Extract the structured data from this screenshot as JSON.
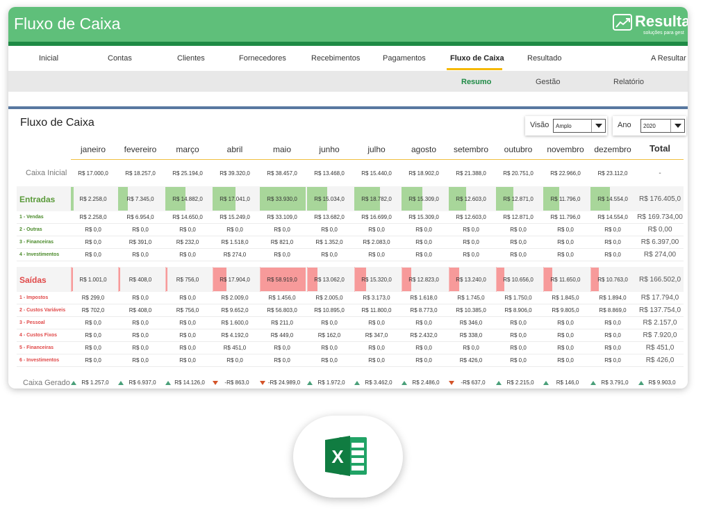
{
  "app": {
    "title": "Fluxo de Caixa",
    "brand": "Resulta",
    "brand_sub": "soluções para gest"
  },
  "nav": [
    "Inicial",
    "Contas",
    "Clientes",
    "Fornecedores",
    "Recebimentos",
    "Pagamentos",
    "Fluxo de Caixa",
    "Resultado",
    "A Resultar"
  ],
  "nav_active": "Fluxo de Caixa",
  "subnav": [
    "Resumo",
    "Gestão",
    "Relatório"
  ],
  "section_title": "Fluxo de Caixa",
  "filters": {
    "visao_label": "Visão",
    "visao_value": "Amplo",
    "ano_label": "Ano",
    "ano_value": "2020"
  },
  "months": [
    "janeiro",
    "fevereiro",
    "março",
    "abril",
    "maio",
    "junho",
    "julho",
    "agosto",
    "setembro",
    "outubro",
    "novembro",
    "dezembro"
  ],
  "total_label": "Total",
  "caixa_inicial": {
    "label": "Caixa Inicial",
    "values": [
      "R$ 17.000,0",
      "R$ 18.257,0",
      "R$ 25.194,0",
      "R$ 39.320,0",
      "R$ 38.457,0",
      "R$ 13.468,0",
      "R$ 15.440,0",
      "R$ 18.902,0",
      "R$ 21.388,0",
      "R$ 20.751,0",
      "R$ 22.966,0",
      "R$ 23.112,0"
    ],
    "total": "-"
  },
  "entradas": {
    "label": "Entradas",
    "values": [
      "R$ 2.258,0",
      "R$ 7.345,0",
      "R$ 14.882,0",
      "R$ 17.041,0",
      "R$ 33.930,0",
      "R$ 15.034,0",
      "R$ 18.782,0",
      "R$ 15.309,0",
      "R$ 12.603,0",
      "R$ 12.871,0",
      "R$ 11.796,0",
      "R$ 14.554,0"
    ],
    "bar_amounts": [
      2258,
      7345,
      14882,
      17041,
      33930,
      15034,
      18782,
      15309,
      12603,
      12871,
      11796,
      14554
    ],
    "total": "R$ 176.405,0",
    "rows": [
      {
        "label": "1 - Vendas",
        "values": [
          "R$ 2.258,0",
          "R$ 6.954,0",
          "R$ 14.650,0",
          "R$ 15.249,0",
          "R$ 33.109,0",
          "R$ 13.682,0",
          "R$ 16.699,0",
          "R$ 15.309,0",
          "R$ 12.603,0",
          "R$ 12.871,0",
          "R$ 11.796,0",
          "R$ 14.554,0"
        ],
        "total": "R$ 169.734,00"
      },
      {
        "label": "2 - Outras",
        "values": [
          "R$ 0,0",
          "R$ 0,0",
          "R$ 0,0",
          "R$ 0,0",
          "R$ 0,0",
          "R$ 0,0",
          "R$ 0,0",
          "R$ 0,0",
          "R$ 0,0",
          "R$ 0,0",
          "R$ 0,0",
          "R$ 0,0"
        ],
        "total": "R$ 0,00"
      },
      {
        "label": "3 - Financeiras",
        "values": [
          "R$ 0,0",
          "R$ 391,0",
          "R$ 232,0",
          "R$ 1.518,0",
          "R$ 821,0",
          "R$ 1.352,0",
          "R$ 2.083,0",
          "R$ 0,0",
          "R$ 0,0",
          "R$ 0,0",
          "R$ 0,0",
          "R$ 0,0"
        ],
        "total": "R$ 6.397,00"
      },
      {
        "label": "4 - Investimentos",
        "values": [
          "R$ 0,0",
          "R$ 0,0",
          "R$ 0,0",
          "R$ 274,0",
          "R$ 0,0",
          "R$ 0,0",
          "R$ 0,0",
          "R$ 0,0",
          "R$ 0,0",
          "R$ 0,0",
          "R$ 0,0",
          "R$ 0,0"
        ],
        "total": "R$ 274,00"
      }
    ]
  },
  "saidas": {
    "label": "Saídas",
    "values": [
      "R$ 1.001,0",
      "R$ 408,0",
      "R$ 756,0",
      "R$ 17.904,0",
      "R$ 58.919,0",
      "R$ 13.062,0",
      "R$ 15.320,0",
      "R$ 12.823,0",
      "R$ 13.240,0",
      "R$ 10.656,0",
      "R$ 11.650,0",
      "R$ 10.763,0"
    ],
    "bar_amounts": [
      1001,
      408,
      756,
      17904,
      58919,
      13062,
      15320,
      12823,
      13240,
      10656,
      11650,
      10763
    ],
    "total": "R$ 166.502,0",
    "rows": [
      {
        "label": "1 - Impostos",
        "values": [
          "R$ 299,0",
          "R$ 0,0",
          "R$ 0,0",
          "R$ 2.009,0",
          "R$ 1.456,0",
          "R$ 2.005,0",
          "R$ 3.173,0",
          "R$ 1.618,0",
          "R$ 1.745,0",
          "R$ 1.750,0",
          "R$ 1.845,0",
          "R$ 1.894,0"
        ],
        "total": "R$ 17.794,0"
      },
      {
        "label": "2 - Custos Variáveis",
        "values": [
          "R$ 702,0",
          "R$ 408,0",
          "R$ 756,0",
          "R$ 9.652,0",
          "R$ 56.803,0",
          "R$ 10.895,0",
          "R$ 11.800,0",
          "R$ 8.773,0",
          "R$ 10.385,0",
          "R$ 8.906,0",
          "R$ 9.805,0",
          "R$ 8.869,0"
        ],
        "total": "R$ 137.754,0"
      },
      {
        "label": "3 - Pessoal",
        "values": [
          "R$ 0,0",
          "R$ 0,0",
          "R$ 0,0",
          "R$ 1.600,0",
          "R$ 211,0",
          "R$ 0,0",
          "R$ 0,0",
          "R$ 0,0",
          "R$ 346,0",
          "R$ 0,0",
          "R$ 0,0",
          "R$ 0,0"
        ],
        "total": "R$ 2.157,0"
      },
      {
        "label": "4 - Custos Fixos",
        "values": [
          "R$ 0,0",
          "R$ 0,0",
          "R$ 0,0",
          "R$ 4.192,0",
          "R$ 449,0",
          "R$ 162,0",
          "R$ 347,0",
          "R$ 2.432,0",
          "R$ 338,0",
          "R$ 0,0",
          "R$ 0,0",
          "R$ 0,0"
        ],
        "total": "R$ 7.920,0"
      },
      {
        "label": "5 - Financeiras",
        "values": [
          "R$ 0,0",
          "R$ 0,0",
          "R$ 0,0",
          "R$ 451,0",
          "R$ 0,0",
          "R$ 0,0",
          "R$ 0,0",
          "R$ 0,0",
          "R$ 0,0",
          "R$ 0,0",
          "R$ 0,0",
          "R$ 0,0"
        ],
        "total": "R$ 451,0"
      },
      {
        "label": "6 - Investimentos",
        "values": [
          "R$ 0,0",
          "R$ 0,0",
          "R$ 0,0",
          "R$ 0,0",
          "R$ 0,0",
          "R$ 0,0",
          "R$ 0,0",
          "R$ 0,0",
          "R$ 426,0",
          "R$ 0,0",
          "R$ 0,0",
          "R$ 0,0"
        ],
        "total": "R$ 426,0"
      }
    ]
  },
  "caixa_gerado": {
    "label": "Caixa Gerado",
    "values": [
      "R$ 1.257,0",
      "R$ 6.937,0",
      "R$ 14.126,0",
      "-R$ 863,0",
      "-R$ 24.989,0",
      "R$ 1.972,0",
      "R$ 3.462,0",
      "R$ 2.486,0",
      "-R$ 637,0",
      "R$ 2.215,0",
      "R$ 146,0",
      "R$ 3.791,0"
    ],
    "trend": [
      "up",
      "up",
      "up",
      "down",
      "down",
      "up",
      "up",
      "up",
      "down",
      "up",
      "up",
      "up"
    ],
    "total": "R$ 9.903,0",
    "total_trend": "up"
  },
  "colors": {
    "green": "#5fbf7a",
    "dark_green": "#1e8a45",
    "entrada_bar": "#a8d69a",
    "saida_bar": "#f79a9a",
    "accent": "#f5b800",
    "saidas_text": "#e04848",
    "entradas_text": "#5a9a3a"
  },
  "icons": [
    "resulta-logo-icon",
    "excel-icon"
  ]
}
